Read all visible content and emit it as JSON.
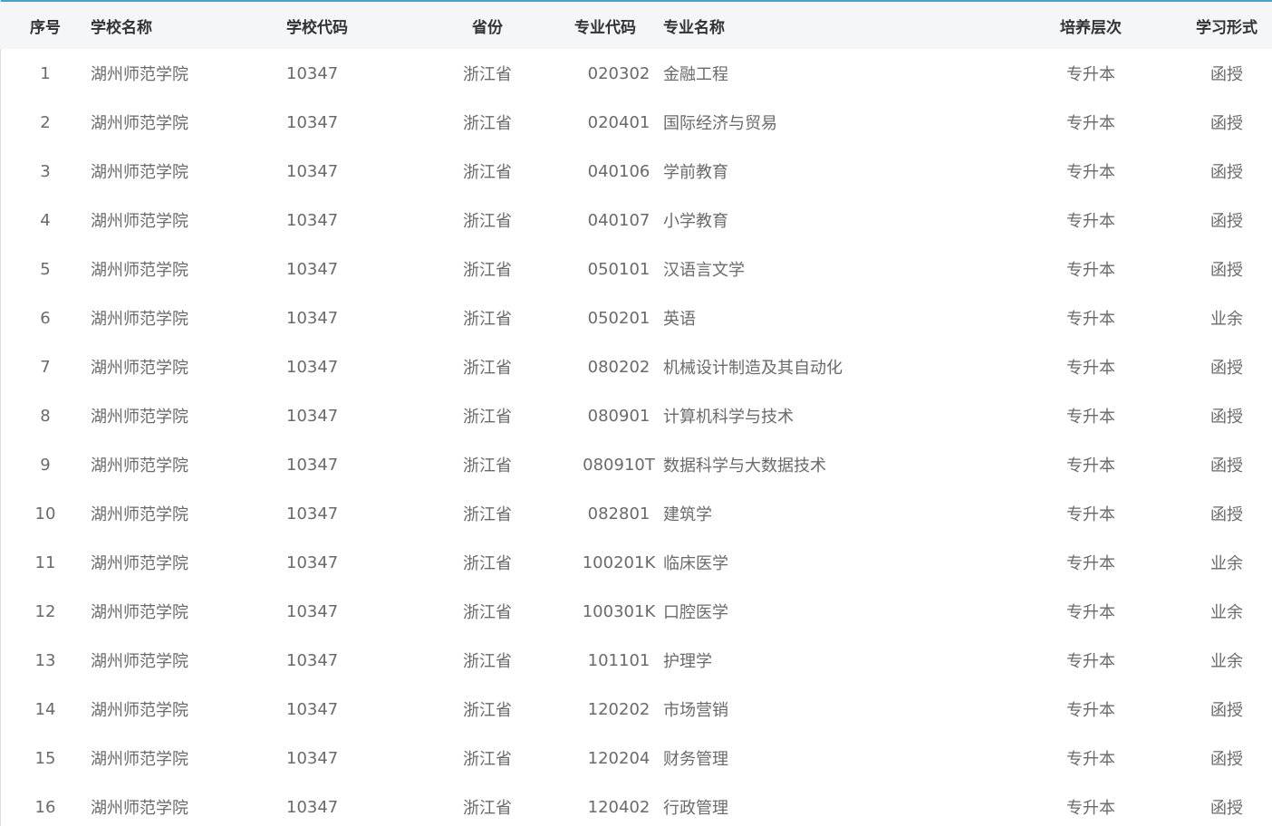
{
  "table": {
    "columns": [
      "序号",
      "学校名称",
      "学校代码",
      "省份",
      "专业代码",
      "专业名称",
      "培养层次",
      "学习形式"
    ],
    "rows": [
      [
        "1",
        "湖州师范学院",
        "10347",
        "浙江省",
        "020302",
        "金融工程",
        "专升本",
        "函授"
      ],
      [
        "2",
        "湖州师范学院",
        "10347",
        "浙江省",
        "020401",
        "国际经济与贸易",
        "专升本",
        "函授"
      ],
      [
        "3",
        "湖州师范学院",
        "10347",
        "浙江省",
        "040106",
        "学前教育",
        "专升本",
        "函授"
      ],
      [
        "4",
        "湖州师范学院",
        "10347",
        "浙江省",
        "040107",
        "小学教育",
        "专升本",
        "函授"
      ],
      [
        "5",
        "湖州师范学院",
        "10347",
        "浙江省",
        "050101",
        "汉语言文学",
        "专升本",
        "函授"
      ],
      [
        "6",
        "湖州师范学院",
        "10347",
        "浙江省",
        "050201",
        "英语",
        "专升本",
        "业余"
      ],
      [
        "7",
        "湖州师范学院",
        "10347",
        "浙江省",
        "080202",
        "机械设计制造及其自动化",
        "专升本",
        "函授"
      ],
      [
        "8",
        "湖州师范学院",
        "10347",
        "浙江省",
        "080901",
        "计算机科学与技术",
        "专升本",
        "函授"
      ],
      [
        "9",
        "湖州师范学院",
        "10347",
        "浙江省",
        "080910T",
        "数据科学与大数据技术",
        "专升本",
        "函授"
      ],
      [
        "10",
        "湖州师范学院",
        "10347",
        "浙江省",
        "082801",
        "建筑学",
        "专升本",
        "函授"
      ],
      [
        "11",
        "湖州师范学院",
        "10347",
        "浙江省",
        "100201K",
        "临床医学",
        "专升本",
        "业余"
      ],
      [
        "12",
        "湖州师范学院",
        "10347",
        "浙江省",
        "100301K",
        "口腔医学",
        "专升本",
        "业余"
      ],
      [
        "13",
        "湖州师范学院",
        "10347",
        "浙江省",
        "101101",
        "护理学",
        "专升本",
        "业余"
      ],
      [
        "14",
        "湖州师范学院",
        "10347",
        "浙江省",
        "120202",
        "市场营销",
        "专升本",
        "函授"
      ],
      [
        "15",
        "湖州师范学院",
        "10347",
        "浙江省",
        "120204",
        "财务管理",
        "专升本",
        "函授"
      ],
      [
        "16",
        "湖州师范学院",
        "10347",
        "浙江省",
        "120402",
        "行政管理",
        "专升本",
        "函授"
      ]
    ]
  },
  "colors": {
    "header_bg": "#f5f6f8",
    "header_text": "#333333",
    "cell_text": "#6a6a6a",
    "top_accent": "#4aa3c7"
  }
}
